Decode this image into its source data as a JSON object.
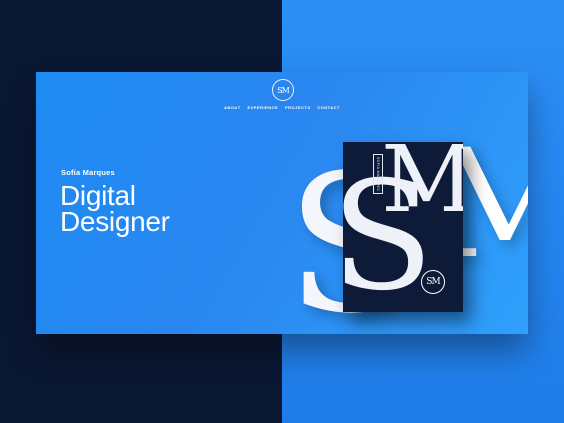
{
  "brand": {
    "monogram": "SM"
  },
  "nav": {
    "items": [
      "ABOUT",
      "EXPERIENCE",
      "PROJECTS",
      "CONTACT"
    ]
  },
  "hero": {
    "name": "Sofia Marques",
    "headline_line1": "Digital",
    "headline_line2": "Designer"
  },
  "decor": {
    "big_s": "S",
    "big_m": "M",
    "book_spine_text": "SOFIA MARQUES",
    "book_monogram": "SM"
  },
  "colors": {
    "dark_navy": "#0b1834",
    "accent_blue": "#1d8bf3",
    "book_navy": "#0d1a38"
  }
}
